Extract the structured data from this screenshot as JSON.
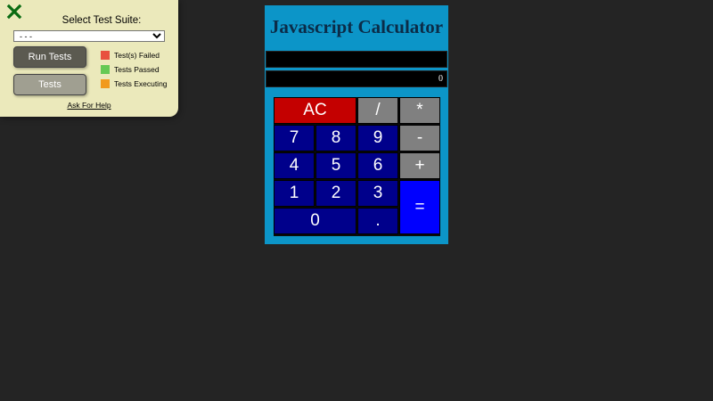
{
  "test_panel": {
    "close_icon": "close-icon",
    "close_color": "#0a6b12",
    "title": "Select Test Suite:",
    "select_value": "- - -",
    "run_button": "Run Tests",
    "tests_button": "Tests",
    "legend": [
      {
        "label": "Test(s) Failed",
        "color": "#e8513f"
      },
      {
        "label": "Tests Passed",
        "color": "#65c954"
      },
      {
        "label": "Tests Executing",
        "color": "#f19a1c"
      }
    ],
    "help_link": "Ask For Help"
  },
  "calculator": {
    "title": "Javascript Calculator",
    "formula": "",
    "output": "0",
    "keys": {
      "clear": "AC",
      "divide": "/",
      "multiply": "*",
      "seven": "7",
      "eight": "8",
      "nine": "9",
      "subtract": "-",
      "four": "4",
      "five": "5",
      "six": "6",
      "add": "+",
      "one": "1",
      "two": "2",
      "three": "3",
      "equals": "=",
      "zero": "0",
      "decimal": "."
    },
    "colors": {
      "body": "#0c95c8",
      "number_key": "#00008b",
      "operator_key": "#808080",
      "clear_key": "#c40000",
      "equals_key": "#0000ff"
    }
  }
}
